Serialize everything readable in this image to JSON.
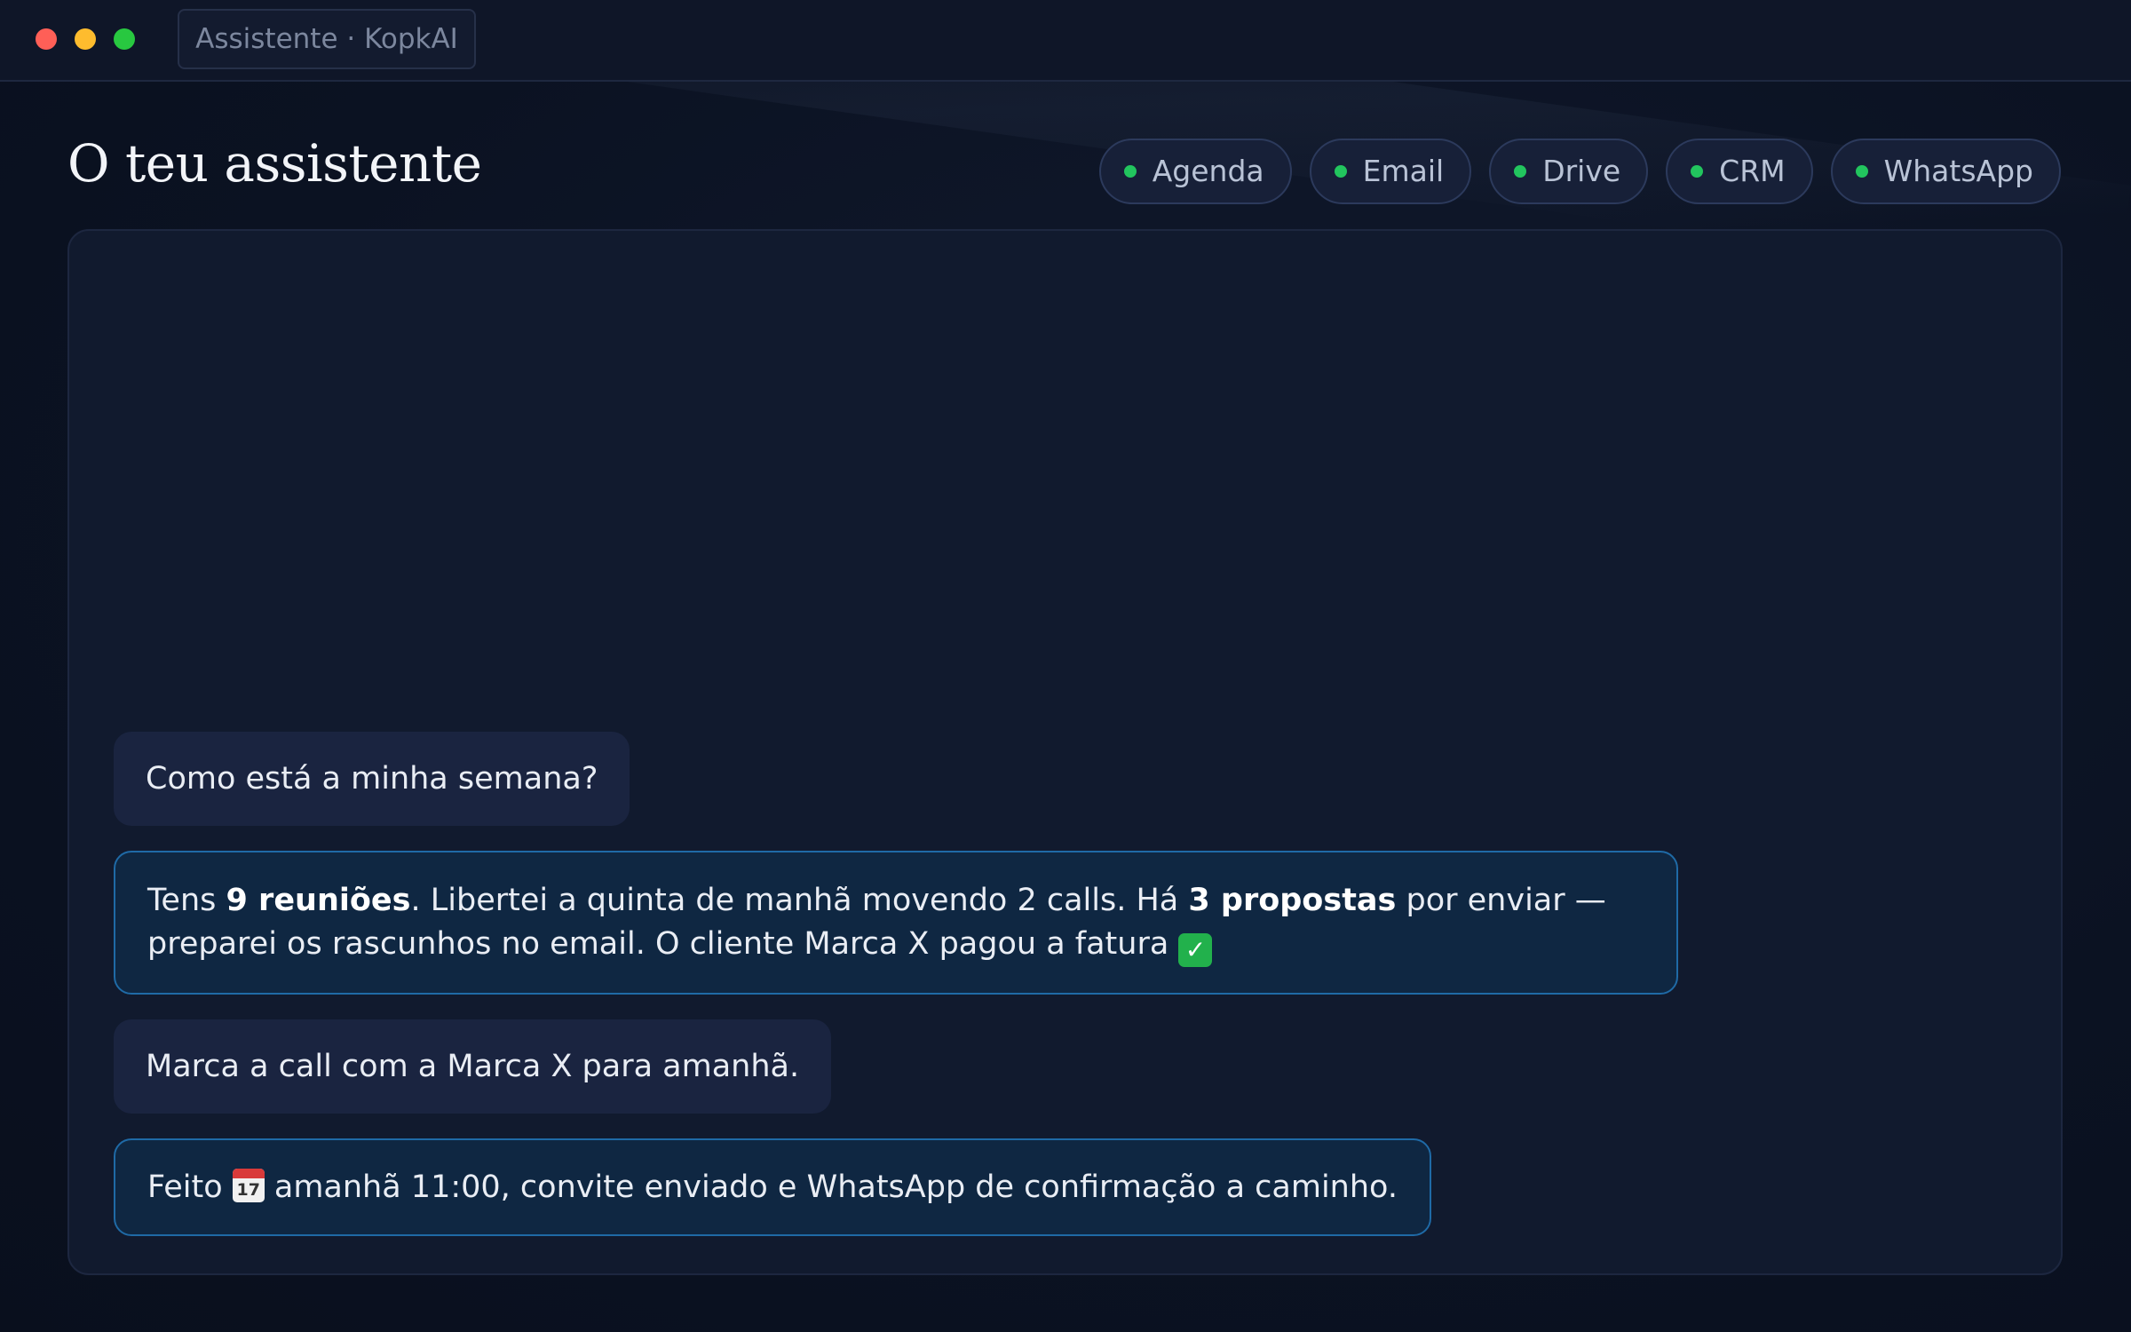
{
  "window": {
    "tab_title": "Assistente · KopkAI"
  },
  "header": {
    "title": "O teu assistente",
    "integrations": [
      {
        "label": "Agenda",
        "status": "connected",
        "status_color": "#22c55e"
      },
      {
        "label": "Email",
        "status": "connected",
        "status_color": "#22c55e"
      },
      {
        "label": "Drive",
        "status": "connected",
        "status_color": "#22c55e"
      },
      {
        "label": "CRM",
        "status": "connected",
        "status_color": "#22c55e"
      },
      {
        "label": "WhatsApp",
        "status": "connected",
        "status_color": "#22c55e"
      }
    ]
  },
  "chat": {
    "messages": [
      {
        "role": "user",
        "text": "Como está a minha semana?"
      },
      {
        "role": "assistant",
        "parts": {
          "p1": "Tens ",
          "b1": "9 reuniões",
          "p2": ". Libertei a quinta de manhã movendo 2 calls. Há ",
          "b2": "3 propostas",
          "p3": " por enviar — preparei os rascunhos no email. O cliente Marca X pagou a fatura ",
          "emoji": "✓",
          "emoji_icon": "check-mark-button-emoji"
        }
      },
      {
        "role": "user",
        "text": "Marca a call com a Marca X para amanhã."
      },
      {
        "role": "assistant",
        "parts": {
          "p1": "Feito ",
          "emoji_day": "17",
          "emoji_icon": "calendar-emoji",
          "p2": " amanhã 11:00, convite enviado e WhatsApp de confirmação a caminho."
        }
      }
    ]
  },
  "colors": {
    "background": "#0b1222",
    "panel": "#111a2e",
    "user_bubble": "#1a2440",
    "assistant_bubble": "#0f2742",
    "assistant_border": "#1f6aa6",
    "status_connected": "#22c55e"
  }
}
